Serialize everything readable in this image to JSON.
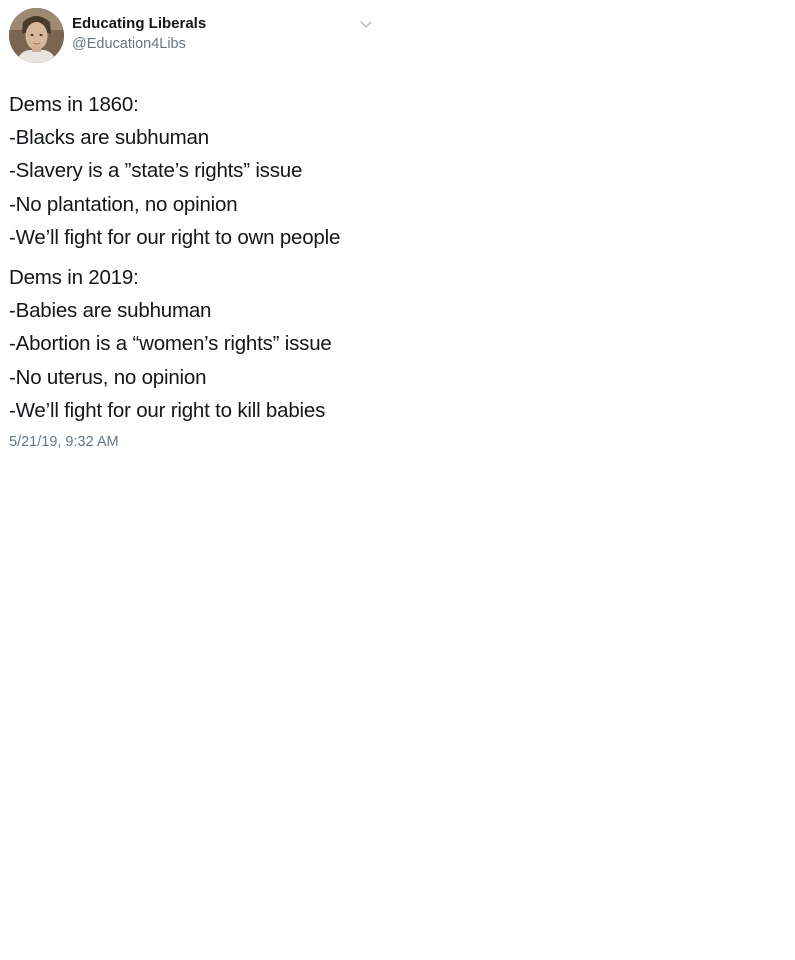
{
  "tweet": {
    "author": {
      "name": "Educating Liberals",
      "handle": "@Education4Libs"
    },
    "menu_icon": "chevron-down-icon",
    "paragraphs": [
      {
        "heading": "Dems in 1860:",
        "lines": [
          "-Blacks are subhuman",
          "-Slavery is a ”state’s rights” issue",
          "-No plantation, no opinion",
          "-We’ll fight for our right to own people"
        ]
      },
      {
        "heading": "Dems in 2019:",
        "lines": [
          "-Babies are subhuman",
          "-Abortion is a “women’s rights” issue",
          "-No uterus, no opinion",
          "-We’ll fight for our right to kill babies"
        ]
      }
    ],
    "timestamp": "5/21/19, 9:32 AM"
  },
  "colors": {
    "text": "#14171a",
    "secondary": "#657786",
    "background": "#ffffff"
  }
}
